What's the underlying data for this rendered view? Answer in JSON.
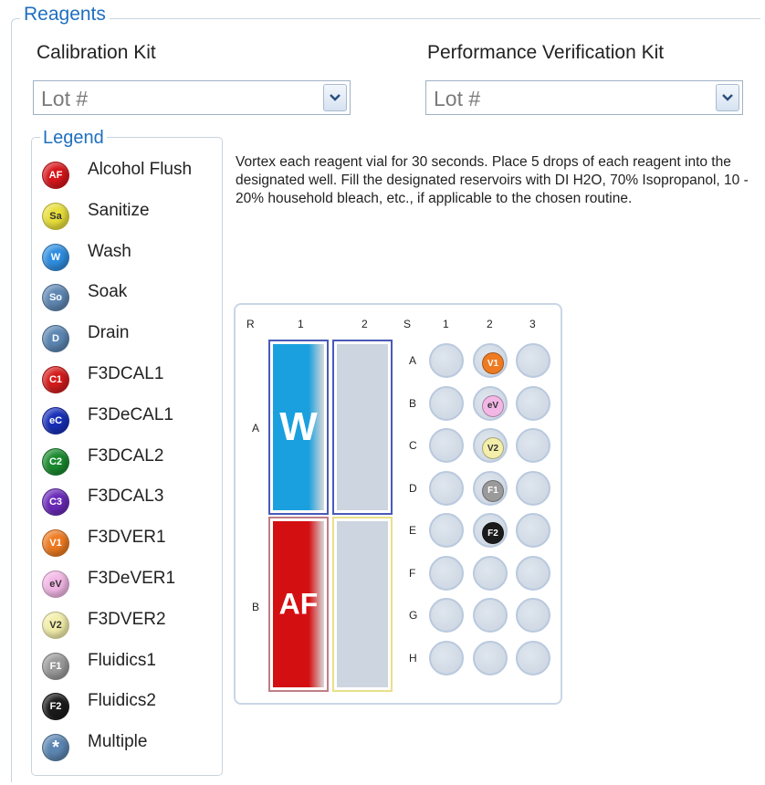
{
  "group_title": "Reagents",
  "calibration": {
    "label": "Calibration Kit",
    "value": "Lot #"
  },
  "verification": {
    "label": "Performance Verification Kit",
    "value": "Lot #"
  },
  "legend": {
    "title": "Legend",
    "items": [
      {
        "abbr": "AF",
        "label": "Alcohol Flush",
        "color": "#d7161b",
        "text_color": "#ffffff"
      },
      {
        "abbr": "Sa",
        "label": "Sanitize",
        "color": "#e8df3a",
        "text_color": "#333333"
      },
      {
        "abbr": "W",
        "label": "Wash",
        "color": "#2f8ee0",
        "text_color": "#ffffff"
      },
      {
        "abbr": "So",
        "label": "Soak",
        "color": "#5f87b3",
        "text_color": "#ffffff"
      },
      {
        "abbr": "D",
        "label": "Drain",
        "color": "#5c86b2",
        "text_color": "#ffffff"
      },
      {
        "abbr": "C1",
        "label": "F3DCAL1",
        "color": "#d41c1c",
        "text_color": "#ffffff"
      },
      {
        "abbr": "eC",
        "label": "F3DeCAL1",
        "color": "#1830b8",
        "text_color": "#ffffff"
      },
      {
        "abbr": "C2",
        "label": "F3DCAL2",
        "color": "#1a8a2e",
        "text_color": "#ffffff"
      },
      {
        "abbr": "C3",
        "label": "F3DCAL3",
        "color": "#6a2ab8",
        "text_color": "#ffffff"
      },
      {
        "abbr": "V1",
        "label": "F3DVER1",
        "color": "#ee7b22",
        "text_color": "#ffffff"
      },
      {
        "abbr": "eV",
        "label": "F3DeVER1",
        "color": "#f3b7e6",
        "text_color": "#333333"
      },
      {
        "abbr": "V2",
        "label": "F3DVER2",
        "color": "#f3eeaa",
        "text_color": "#333333"
      },
      {
        "abbr": "F1",
        "label": "Fluidics1",
        "color": "#9a9a9a",
        "text_color": "#ffffff"
      },
      {
        "abbr": "F2",
        "label": "Fluidics2",
        "color": "#1b1b1b",
        "text_color": "#ffffff"
      },
      {
        "abbr": "*",
        "label": "Multiple",
        "color": "#5c86b2",
        "text_color": "#ffffff"
      }
    ]
  },
  "instructions": "Vortex each reagent vial for 30 seconds. Place 5 drops of each reagent into the designated well. Fill the designated reservoirs with DI H2O, 70% Isopropanol, 10 - 20% household bleach, etc., if applicable to the chosen routine.",
  "plate": {
    "reservoir_header": "R",
    "reservoir_columns": [
      "1",
      "2"
    ],
    "reservoir_rows": [
      "A",
      "B"
    ],
    "reservoirs": [
      {
        "row": "A",
        "col": "1",
        "label": "W",
        "fill": "#1aa0de",
        "border": "#4a5ab8"
      },
      {
        "row": "A",
        "col": "2",
        "label": "",
        "fill": "#ccd5e0",
        "border": "#4a5ab8"
      },
      {
        "row": "B",
        "col": "1",
        "label": "AF",
        "fill": "#d40f12",
        "border": "#c07d86"
      },
      {
        "row": "B",
        "col": "2",
        "label": "",
        "fill": "#ccd5e0",
        "border": "#e8e08a"
      }
    ],
    "well_header": "S",
    "well_columns": [
      "1",
      "2",
      "3"
    ],
    "well_rows": [
      "A",
      "B",
      "C",
      "D",
      "E",
      "F",
      "G",
      "H"
    ],
    "filled_wells": [
      {
        "row": "A",
        "col": "2",
        "abbr": "V1",
        "color": "#ee7b22",
        "text_color": "#ffffff"
      },
      {
        "row": "B",
        "col": "2",
        "abbr": "eV",
        "color": "#f3b7e6",
        "text_color": "#333333"
      },
      {
        "row": "C",
        "col": "2",
        "abbr": "V2",
        "color": "#f3eeaa",
        "text_color": "#333333"
      },
      {
        "row": "D",
        "col": "2",
        "abbr": "F1",
        "color": "#9a9a9a",
        "text_color": "#ffffff"
      },
      {
        "row": "E",
        "col": "2",
        "abbr": "F2",
        "color": "#1b1b1b",
        "text_color": "#ffffff"
      }
    ]
  }
}
